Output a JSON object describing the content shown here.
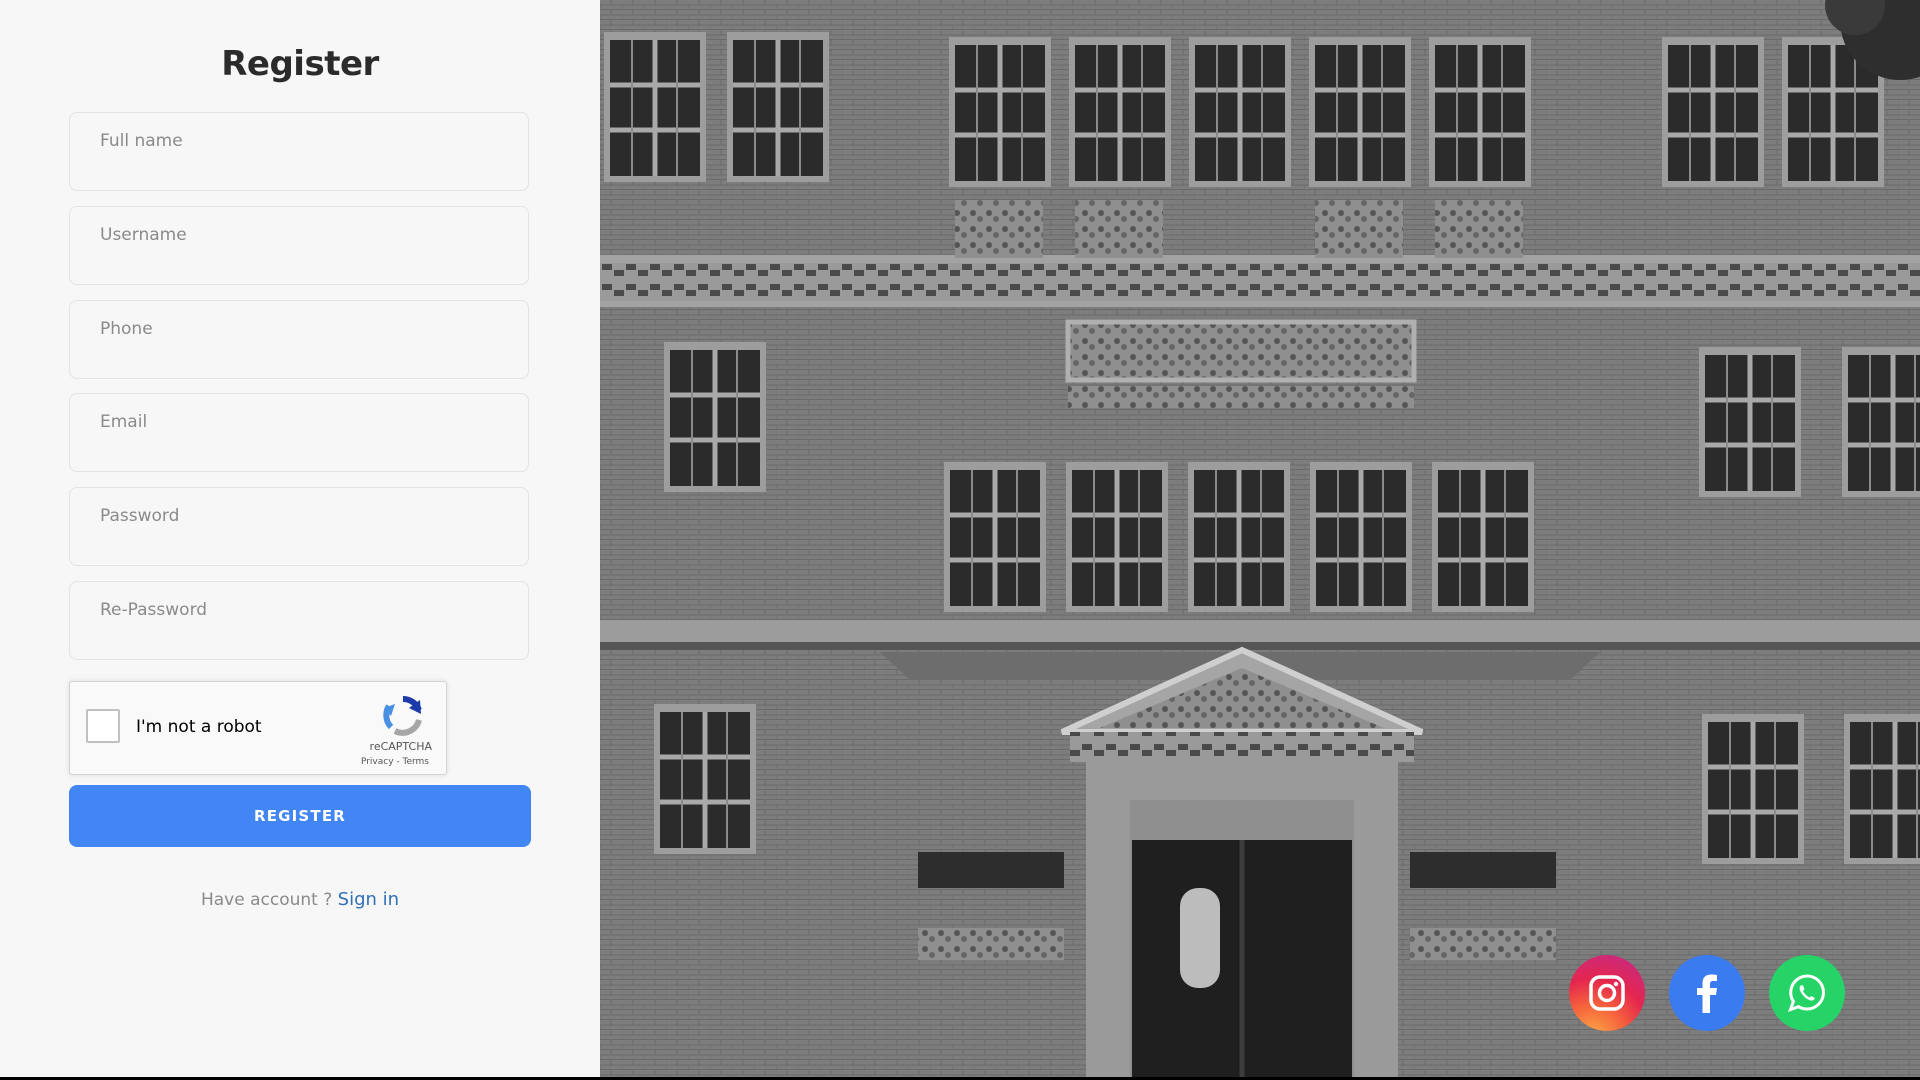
{
  "form": {
    "title": "Register",
    "fields": [
      {
        "name": "full-name",
        "placeholder": "Full name",
        "value": ""
      },
      {
        "name": "username",
        "placeholder": "Username",
        "value": ""
      },
      {
        "name": "phone",
        "placeholder": "Phone",
        "value": ""
      },
      {
        "name": "email",
        "placeholder": "Email",
        "value": ""
      },
      {
        "name": "password",
        "placeholder": "Password",
        "value": ""
      },
      {
        "name": "re-password",
        "placeholder": "Re-Password",
        "value": ""
      }
    ],
    "recaptcha": {
      "label": "I'm not a robot",
      "brand": "reCAPTCHA",
      "terms": "Privacy - Terms",
      "checked": false
    },
    "register_label": "REGISTER",
    "signin_prompt": "Have account ?",
    "signin_link": "Sign in"
  },
  "social": [
    {
      "icon": "instagram-icon",
      "color": "#e4264f"
    },
    {
      "icon": "facebook-icon",
      "color": "#3b7bf0"
    },
    {
      "icon": "whatsapp-icon",
      "color": "#25d366"
    }
  ],
  "colors": {
    "accent": "#4285f4",
    "link": "#2f6fb7",
    "panel_bg": "#f7f7f7"
  }
}
